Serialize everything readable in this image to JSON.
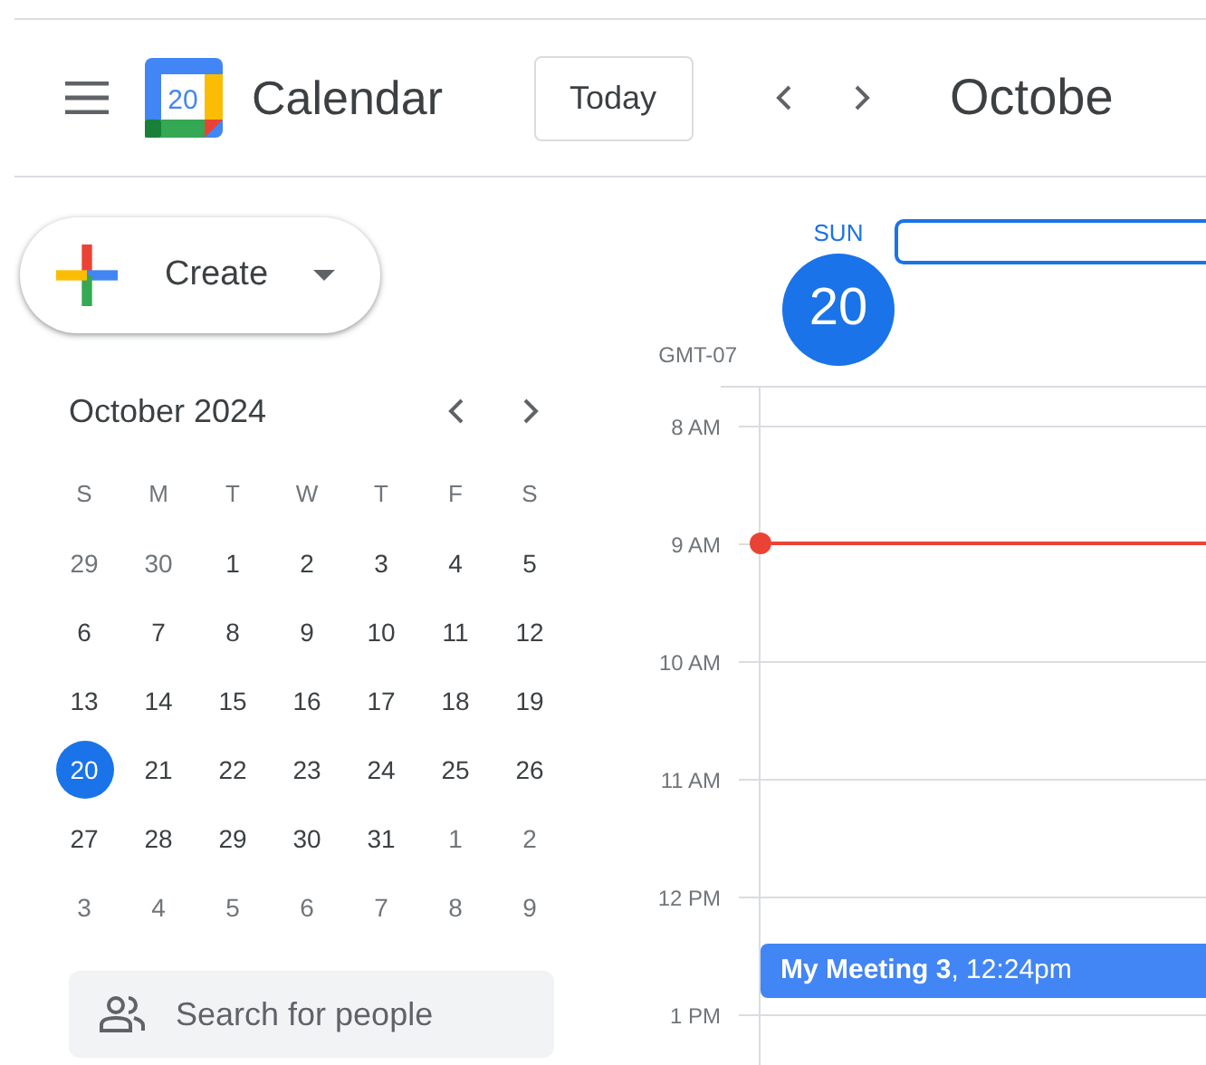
{
  "header": {
    "logo_number": "20",
    "app_title": "Calendar",
    "today_button": "Today",
    "period_title": "Octobe"
  },
  "create_button": {
    "label": "Create"
  },
  "mini_calendar": {
    "title": "October 2024",
    "weekdays": [
      "S",
      "M",
      "T",
      "W",
      "T",
      "F",
      "S"
    ],
    "weeks": [
      [
        {
          "day": "29",
          "in_month": false,
          "selected": false
        },
        {
          "day": "30",
          "in_month": false,
          "selected": false
        },
        {
          "day": "1",
          "in_month": true,
          "selected": false
        },
        {
          "day": "2",
          "in_month": true,
          "selected": false
        },
        {
          "day": "3",
          "in_month": true,
          "selected": false
        },
        {
          "day": "4",
          "in_month": true,
          "selected": false
        },
        {
          "day": "5",
          "in_month": true,
          "selected": false
        }
      ],
      [
        {
          "day": "6",
          "in_month": true,
          "selected": false
        },
        {
          "day": "7",
          "in_month": true,
          "selected": false
        },
        {
          "day": "8",
          "in_month": true,
          "selected": false
        },
        {
          "day": "9",
          "in_month": true,
          "selected": false
        },
        {
          "day": "10",
          "in_month": true,
          "selected": false
        },
        {
          "day": "11",
          "in_month": true,
          "selected": false
        },
        {
          "day": "12",
          "in_month": true,
          "selected": false
        }
      ],
      [
        {
          "day": "13",
          "in_month": true,
          "selected": false
        },
        {
          "day": "14",
          "in_month": true,
          "selected": false
        },
        {
          "day": "15",
          "in_month": true,
          "selected": false
        },
        {
          "day": "16",
          "in_month": true,
          "selected": false
        },
        {
          "day": "17",
          "in_month": true,
          "selected": false
        },
        {
          "day": "18",
          "in_month": true,
          "selected": false
        },
        {
          "day": "19",
          "in_month": true,
          "selected": false
        }
      ],
      [
        {
          "day": "20",
          "in_month": true,
          "selected": true
        },
        {
          "day": "21",
          "in_month": true,
          "selected": false
        },
        {
          "day": "22",
          "in_month": true,
          "selected": false
        },
        {
          "day": "23",
          "in_month": true,
          "selected": false
        },
        {
          "day": "24",
          "in_month": true,
          "selected": false
        },
        {
          "day": "25",
          "in_month": true,
          "selected": false
        },
        {
          "day": "26",
          "in_month": true,
          "selected": false
        }
      ],
      [
        {
          "day": "27",
          "in_month": true,
          "selected": false
        },
        {
          "day": "28",
          "in_month": true,
          "selected": false
        },
        {
          "day": "29",
          "in_month": true,
          "selected": false
        },
        {
          "day": "30",
          "in_month": true,
          "selected": false
        },
        {
          "day": "31",
          "in_month": true,
          "selected": false
        },
        {
          "day": "1",
          "in_month": false,
          "selected": false
        },
        {
          "day": "2",
          "in_month": false,
          "selected": false
        }
      ],
      [
        {
          "day": "3",
          "in_month": false,
          "selected": false
        },
        {
          "day": "4",
          "in_month": false,
          "selected": false
        },
        {
          "day": "5",
          "in_month": false,
          "selected": false
        },
        {
          "day": "6",
          "in_month": false,
          "selected": false
        },
        {
          "day": "7",
          "in_month": false,
          "selected": false
        },
        {
          "day": "8",
          "in_month": false,
          "selected": false
        },
        {
          "day": "9",
          "in_month": false,
          "selected": false
        }
      ]
    ]
  },
  "search_people": {
    "placeholder": "Search for people"
  },
  "day_view": {
    "weekday": "SUN",
    "date": "20",
    "timezone": "GMT-07",
    "hours": [
      "8 AM",
      "9 AM",
      "10 AM",
      "11 AM",
      "12 PM",
      "1 PM"
    ],
    "events": [
      {
        "text": "**My Meeting 3**, 12:24pm"
      }
    ]
  }
}
